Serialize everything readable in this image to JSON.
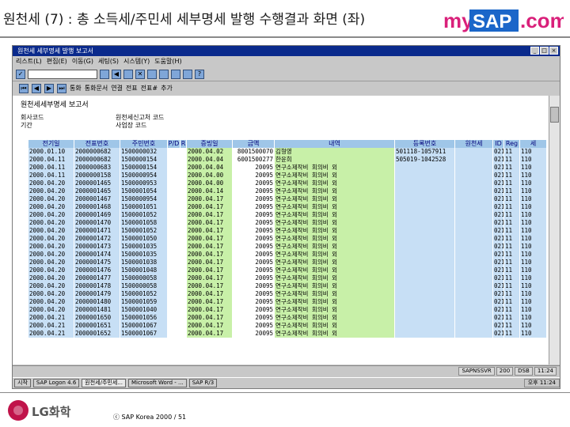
{
  "slide": {
    "title": "원천세 (7) : 총 소득세/주민세 세부명세 발행 수행결과 화면 (좌)",
    "brand": "mySAP.com",
    "company_logo": "LG화학",
    "copyright": "ⓒ SAP Korea 2000 / 51"
  },
  "window": {
    "title": "원천세 세부명세 발행 보고서",
    "menu": [
      "리스트(L)",
      "편집(E)",
      "이동(G)",
      "세팅(S)",
      "시스템(Y)",
      "도움말(H)"
    ],
    "app_toolbar": [
      "통화",
      "통화문서",
      "연결",
      "전표",
      "전표#",
      "추가"
    ]
  },
  "report": {
    "heading": "원천세세부명세 보고서",
    "meta_left": [
      "회사코드",
      "기간"
    ],
    "meta_right": [
      "원천세신고처 코드",
      "사업장 코드"
    ]
  },
  "table": {
    "headers": [
      "전기일",
      "전표번호",
      "주민번호",
      "P/D",
      "R",
      "증빙일",
      "금액",
      "내역",
      "등록번호",
      "원천세",
      "ID",
      "Reg",
      "세"
    ],
    "rows": [
      [
        "2000.01.10",
        "2000000682",
        "1500000032",
        "",
        "",
        "2000.04.02",
        "",
        "",
        "",
        "",
        "",
        "",
        ""
      ],
      [
        "2000.04.11",
        "2000000682",
        "1500000154",
        "",
        "",
        "2000.04.04",
        "",
        "",
        "",
        "",
        "",
        "",
        ""
      ],
      [
        "2000.04.11",
        "2000000683",
        "1500000154",
        "",
        "",
        "2000.04.04",
        "",
        "",
        "",
        "",
        "",
        "",
        ""
      ],
      [
        "2000.04.11",
        "2000000158",
        "1500000954",
        "",
        "",
        "2000.04.00",
        "",
        "",
        "",
        "",
        "",
        "",
        ""
      ],
      [
        "2000.04.20",
        "2000001465",
        "1500000953",
        "",
        "",
        "2000.04.00",
        "",
        "",
        "",
        "",
        "",
        "",
        ""
      ],
      [
        "2000.04.20",
        "2000001465",
        "1500001054",
        "",
        "",
        "2000.04.14",
        "",
        "",
        "",
        "",
        "",
        "",
        ""
      ],
      [
        "2000.04.20",
        "2000001467",
        "1500000954",
        "",
        "",
        "2000.04.17",
        "",
        "",
        "",
        "",
        "",
        "",
        ""
      ],
      [
        "2000.04.20",
        "2000001468",
        "1500001051",
        "",
        "",
        "2000.04.17",
        "",
        "",
        "",
        "",
        "",
        "",
        ""
      ],
      [
        "2000.04.20",
        "2000001469",
        "1500001052",
        "",
        "",
        "2000.04.17",
        "",
        "",
        "",
        "",
        "",
        "",
        ""
      ],
      [
        "2000.04.20",
        "2000001470",
        "1500001058",
        "",
        "",
        "2000.04.17",
        "",
        "",
        "",
        "",
        "",
        "",
        ""
      ],
      [
        "2000.04.20",
        "2000001471",
        "1500001052",
        "",
        "",
        "2000.04.17",
        "",
        "",
        "",
        "",
        "",
        "",
        ""
      ],
      [
        "2000.04.20",
        "2000001472",
        "1500001050",
        "",
        "",
        "2000.04.17",
        "",
        "",
        "",
        "",
        "",
        "",
        ""
      ],
      [
        "2000.04.20",
        "2000001473",
        "1500001035",
        "",
        "",
        "2000.04.17",
        "",
        "",
        "",
        "",
        "",
        "",
        ""
      ],
      [
        "2000.04.20",
        "2000001474",
        "1500001035",
        "",
        "",
        "2000.04.17",
        "",
        "",
        "",
        "",
        "",
        "",
        ""
      ],
      [
        "2000.04.20",
        "2000001475",
        "1500001038",
        "",
        "",
        "2000.04.17",
        "",
        "",
        "",
        "",
        "",
        "",
        ""
      ],
      [
        "2000.04.20",
        "2000001476",
        "1500001048",
        "",
        "",
        "2000.04.17",
        "",
        "",
        "",
        "",
        "",
        "",
        ""
      ],
      [
        "2000.04.20",
        "2000001477",
        "1500000058",
        "",
        "",
        "2000.04.17",
        "",
        "",
        "",
        "",
        "",
        "",
        ""
      ],
      [
        "2000.04.20",
        "2000001478",
        "1500000058",
        "",
        "",
        "2000.04.17",
        "",
        "",
        "",
        "",
        "",
        "",
        ""
      ],
      [
        "2000.04.20",
        "2000001479",
        "1500001052",
        "",
        "",
        "2000.04.17",
        "",
        "",
        "",
        "",
        "",
        "",
        ""
      ],
      [
        "2000.04.20",
        "2000001480",
        "1500001059",
        "",
        "",
        "2000.04.17",
        "",
        "",
        "",
        "",
        "",
        "",
        ""
      ],
      [
        "2000.04.20",
        "2000001481",
        "1500001040",
        "",
        "",
        "2000.04.17",
        "",
        "",
        "",
        "",
        "",
        "",
        ""
      ],
      [
        "2000.04.21",
        "2000001650",
        "1500001056",
        "",
        "",
        "2000.04.17",
        "",
        "",
        "",
        "",
        "",
        "",
        ""
      ],
      [
        "2000.04.21",
        "2000001651",
        "1500001067",
        "",
        "",
        "2000.04.17",
        "",
        "",
        "",
        "",
        "",
        "",
        ""
      ],
      [
        "2000.04.21",
        "2000001652",
        "1500001067",
        "",
        "",
        "2000.04.17",
        "",
        "",
        "",
        "",
        "",
        "",
        ""
      ]
    ],
    "amounts": [
      "8001500070",
      "6001500277",
      "20095",
      "20095",
      "20095",
      "20095",
      "20095",
      "20095",
      "20095",
      "20095",
      "20095",
      "20095",
      "20095",
      "20095",
      "20095",
      "20095",
      "20095",
      "20095",
      "20095",
      "20095",
      "20095",
      "20095",
      "20095",
      "20095"
    ],
    "first_desc": [
      "김형영",
      "한윤희"
    ],
    "repeat_desc": "연구소제작비 회의비 외",
    "first_reg": [
      "501118-1057911",
      "505019-1042528"
    ],
    "tail": [
      "021",
      "11",
      "110"
    ]
  },
  "status": {
    "sys": "SAPNSSVR",
    "client": "200",
    "server": "DSB",
    "time": "11:24"
  },
  "taskbar": {
    "start": "시작",
    "items": [
      "SAP Logon 4.6",
      "원천세/주민세...",
      "Microsoft Word - ...",
      "SAP R/3"
    ],
    "clock": "오후 11:24"
  },
  "colors": {
    "header_bg": "#9fc6e8",
    "key_bg": "#c7dff5",
    "text_bg": "#c8f0a8",
    "titlebar": "#0a2a8c",
    "logo": "#c0134a"
  }
}
